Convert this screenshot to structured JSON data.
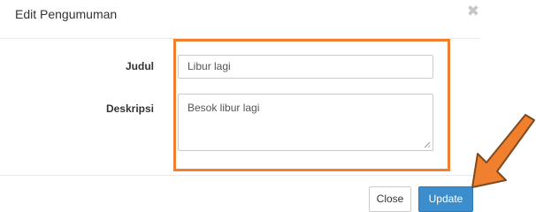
{
  "modal": {
    "title": "Edit Pengumuman",
    "close_glyph": "✖"
  },
  "form": {
    "judul_label": "Judul",
    "judul_value": "Libur lagi",
    "deskripsi_label": "Deskripsi",
    "deskripsi_value": "Besok libur lagi"
  },
  "footer": {
    "close_label": "Close",
    "update_label": "Update"
  },
  "annotations": {
    "highlight_color": "#f07f2e",
    "arrow_color": "#f07f2e"
  },
  "colors": {
    "primary_button": "#3c8dcc"
  }
}
